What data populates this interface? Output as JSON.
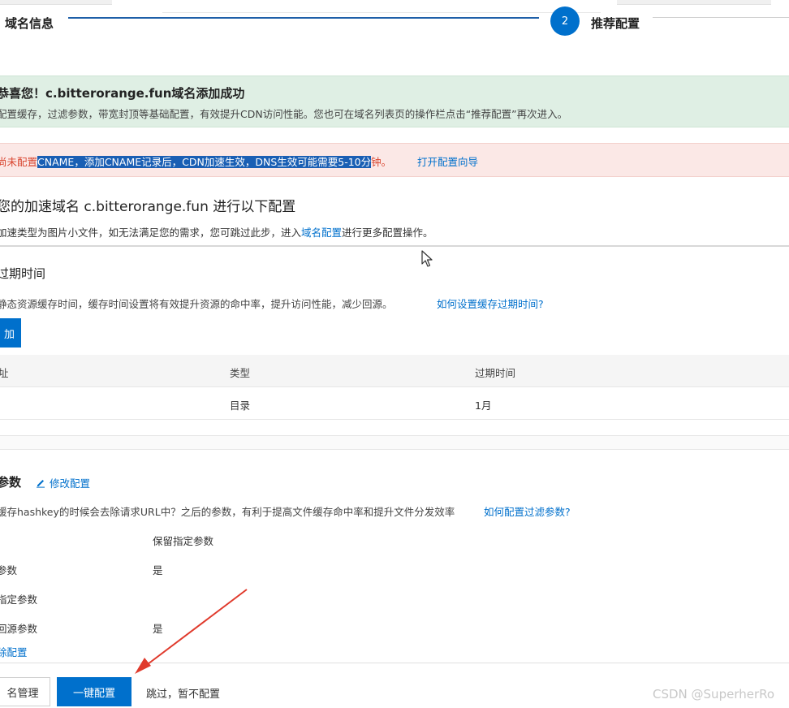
{
  "stepper": {
    "step1_label": "域名信息",
    "step2_number": "2",
    "step2_label": "推荐配置"
  },
  "success_banner": {
    "title": "恭喜您！c.bitterorange.fun域名添加成功",
    "desc": "配置缓存，过滤参数，带宽封顶等基础配置，有效提升CDN访问性能。您也可在域名列表页的操作栏点击“推荐配置”再次进入。"
  },
  "warning_banner": {
    "prefix": "尚未配置",
    "highlighted": "CNAME，添加CNAME记录后，CDN加速生效，DNS生效可能需要5-10分",
    "suffix": "钟。",
    "link": "打开配置向导"
  },
  "config": {
    "title": "您的加速域名 c.bitterorange.fun 进行以下配置",
    "sub_prefix": "加速类型为图片小文件，如无法满足您的需求，您可跳过此步，进入",
    "sub_link": "域名配置",
    "sub_suffix": "进行更多配置操作。"
  },
  "expiry": {
    "title": "过期时间",
    "desc": "静态资源缓存时间，缓存时间设置将有效提升资源的命中率，提升访问性能，减少回源。",
    "help_link": "如何设置缓存过期时间?",
    "add_button": "加",
    "columns": [
      "址",
      "类型",
      "过期时间"
    ],
    "rows": [
      {
        "addr": "",
        "type": "目录",
        "expire": "1月"
      }
    ]
  },
  "filter": {
    "title": "参数",
    "edit_link": "修改配置",
    "desc": "缓存hashkey的时候会去除请求URL中？之后的参数，有利于提高文件缓存命中率和提升文件分发效率",
    "help_link": "如何配置过滤参数?",
    "column": "保留指定参数",
    "items": [
      {
        "label": "参数",
        "value": "是"
      },
      {
        "label": "指定参数",
        "value": ""
      },
      {
        "label": "回源参数",
        "value": "是"
      }
    ],
    "delete_link": "除配置"
  },
  "footer": {
    "domain_button": "名管理",
    "oneclick_button": "一键配置",
    "skip_text": "跳过，暂不配置"
  },
  "watermark": "CSDN @SuperherRo",
  "colors": {
    "primary": "#0070cc",
    "success_bg": "#dfefe4",
    "warning_bg": "#fbe8e6",
    "warning_text": "#d9452f",
    "highlight": "#1a5fb4"
  }
}
